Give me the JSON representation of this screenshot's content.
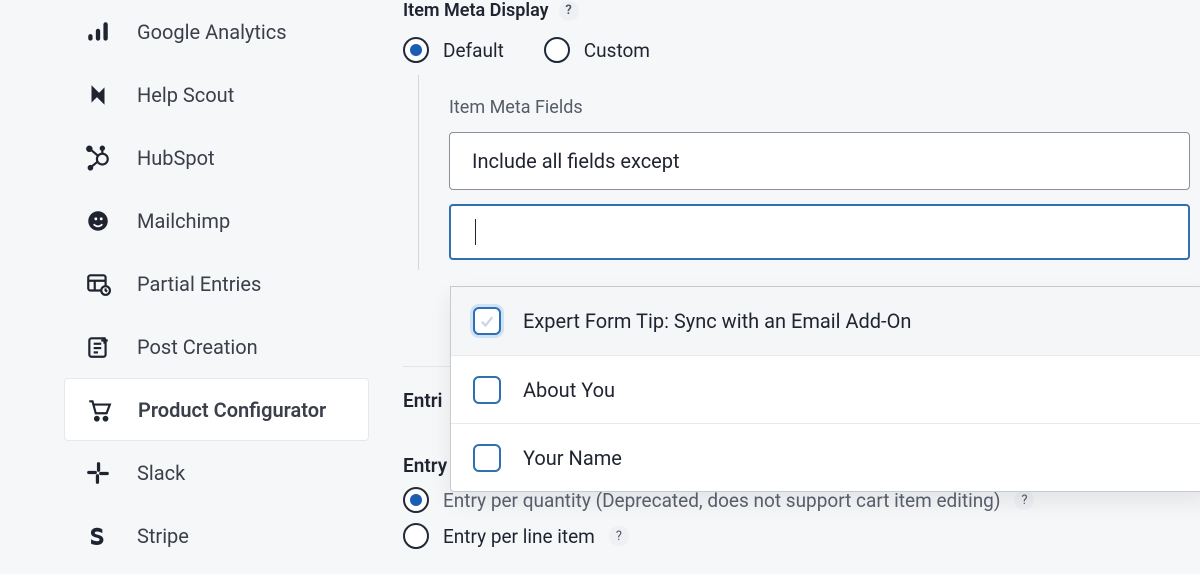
{
  "sidebar": {
    "items": [
      {
        "label": "Google Analytics",
        "icon": "analytics"
      },
      {
        "label": "Help Scout",
        "icon": "helpscout"
      },
      {
        "label": "HubSpot",
        "icon": "hubspot"
      },
      {
        "label": "Mailchimp",
        "icon": "mailchimp"
      },
      {
        "label": "Partial Entries",
        "icon": "partial"
      },
      {
        "label": "Post Creation",
        "icon": "postcreate"
      },
      {
        "label": "Product Configurator",
        "icon": "cart",
        "active": true
      },
      {
        "label": "Slack",
        "icon": "slack"
      },
      {
        "label": "Stripe",
        "icon": "stripe"
      }
    ]
  },
  "meta_display": {
    "title": "Item Meta Display",
    "options": {
      "default": "Default",
      "custom": "Custom"
    },
    "selected": "default",
    "fields_label": "Item Meta Fields",
    "select_value": "Include all fields except",
    "dropdown_options": [
      "Expert Form Tip: Sync with an Email Add-On",
      "About You",
      "Your Name"
    ]
  },
  "entries_section": {
    "title_partial": "Entri",
    "entry_label_partial": "Entry",
    "option_quantity": "Entry per quantity (Deprecated, does not support cart item editing)",
    "option_lineitem": "Entry per line item",
    "selected": "quantity"
  },
  "help_char": "?"
}
